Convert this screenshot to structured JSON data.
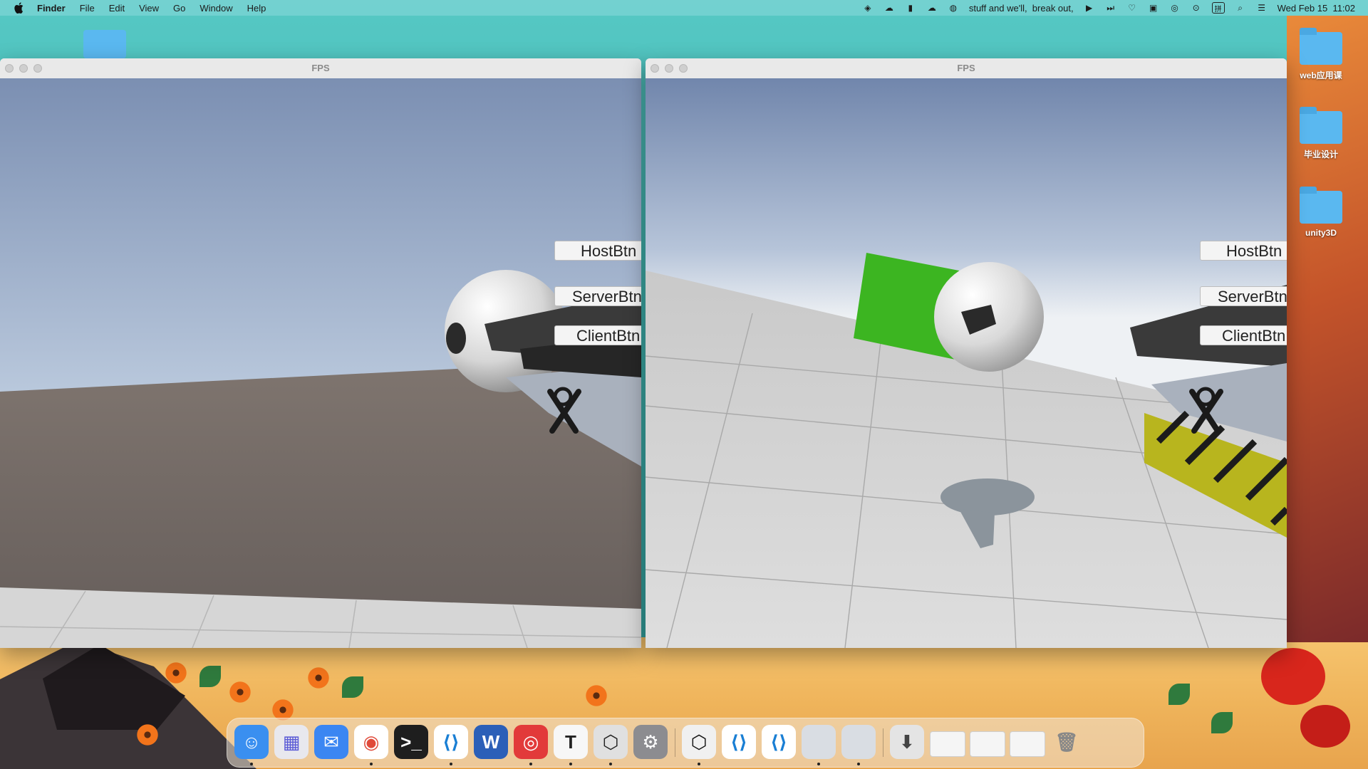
{
  "menubar": {
    "apple_icon": "apple-logo-icon",
    "app_name": "Finder",
    "items": [
      "File",
      "Edit",
      "View",
      "Go",
      "Window",
      "Help"
    ],
    "now_playing": "stuff and we'll,  break out,",
    "datetime": "Wed Feb 15  11:02",
    "status_icons": [
      "unity-icon",
      "creative-cloud-icon",
      "bookmark-icon",
      "cloud-icon",
      "app-icon",
      "play-icon",
      "next-track-icon",
      "heart-icon",
      "trash-icon",
      "netease-icon",
      "play-circle-icon",
      "input-method-icon",
      "search-icon",
      "control-center-icon"
    ],
    "input_method_label": "拼"
  },
  "desktop": {
    "folders": [
      {
        "label": "web应用课"
      },
      {
        "label": "毕业设计"
      },
      {
        "label": "unity3D"
      }
    ]
  },
  "windows": [
    {
      "title": "FPS",
      "buttons": [
        "HostBtn",
        "ServerBtn",
        "ClientBtn"
      ]
    },
    {
      "title": "FPS",
      "buttons": [
        "HostBtn",
        "ServerBtn",
        "ClientBtn"
      ]
    }
  ],
  "dock": {
    "apps": [
      {
        "name": "finder-icon",
        "glyph": "☺",
        "bg": "#3a8ff0",
        "color": "#ffffff",
        "running": true
      },
      {
        "name": "launchpad-icon",
        "glyph": "▦",
        "bg": "#e8e8ee",
        "color": "#5a5ad6",
        "running": false
      },
      {
        "name": "mail-icon",
        "glyph": "✉",
        "bg": "#3b86f2",
        "color": "#ffffff",
        "running": false
      },
      {
        "name": "chrome-icon",
        "glyph": "◉",
        "bg": "#ffffff",
        "color": "#e04a3a",
        "running": true
      },
      {
        "name": "terminal-icon",
        "glyph": ">_",
        "bg": "#1e1e1e",
        "color": "#ffffff",
        "running": false
      },
      {
        "name": "vscode-icon",
        "glyph": "⟨⟩",
        "bg": "#ffffff",
        "color": "#1a7fd4",
        "running": true
      },
      {
        "name": "word-icon",
        "glyph": "W",
        "bg": "#2b5fb8",
        "color": "#ffffff",
        "running": false
      },
      {
        "name": "netease-music-icon",
        "glyph": "◎",
        "bg": "#e23a3a",
        "color": "#ffffff",
        "running": true
      },
      {
        "name": "typora-icon",
        "glyph": "T",
        "bg": "#f7f7f7",
        "color": "#222222",
        "running": true
      },
      {
        "name": "unity-hub-icon",
        "glyph": "⬡",
        "bg": "#e0e0e0",
        "color": "#222222",
        "running": true
      },
      {
        "name": "system-preferences-icon",
        "glyph": "⚙",
        "bg": "#8c8c90",
        "color": "#ffffff",
        "running": false
      },
      {
        "name": "unity-icon",
        "glyph": "⬡",
        "bg": "#f0f0f0",
        "color": "#111111",
        "running": true
      },
      {
        "name": "vscode-icon",
        "glyph": "⟨⟩",
        "bg": "#ffffff",
        "color": "#1a7fd4",
        "running": false
      },
      {
        "name": "vscode-icon",
        "glyph": "⟨⟩",
        "bg": "#ffffff",
        "color": "#1a7fd4",
        "running": false
      },
      {
        "name": "app-window-icon",
        "glyph": "",
        "bg": "#d9dde3",
        "color": "#222222",
        "running": true
      },
      {
        "name": "app-window-icon",
        "glyph": "",
        "bg": "#d9dde3",
        "color": "#222222",
        "running": true
      },
      {
        "name": "downloads-icon",
        "glyph": "⬇",
        "bg": "#e4e4e4",
        "color": "#444444",
        "running": false
      },
      {
        "name": "minimized-window-icon",
        "glyph": "",
        "bg": "#f5f5f5",
        "color": "#222222",
        "running": false
      },
      {
        "name": "minimized-window-icon",
        "glyph": "",
        "bg": "#f5f5f5",
        "color": "#222222",
        "running": false
      },
      {
        "name": "minimized-window-icon",
        "glyph": "",
        "bg": "#f5f5f5",
        "color": "#222222",
        "running": false
      },
      {
        "name": "trash-icon",
        "glyph": "🗑",
        "bg": "transparent",
        "color": "#888888",
        "running": false
      }
    ]
  },
  "colors": {
    "menubar_bg": "#78d2d2",
    "wallpaper_sky": "#43bab5",
    "green_cube": "#3cb521",
    "hazard_yellow": "#b8b51e"
  }
}
